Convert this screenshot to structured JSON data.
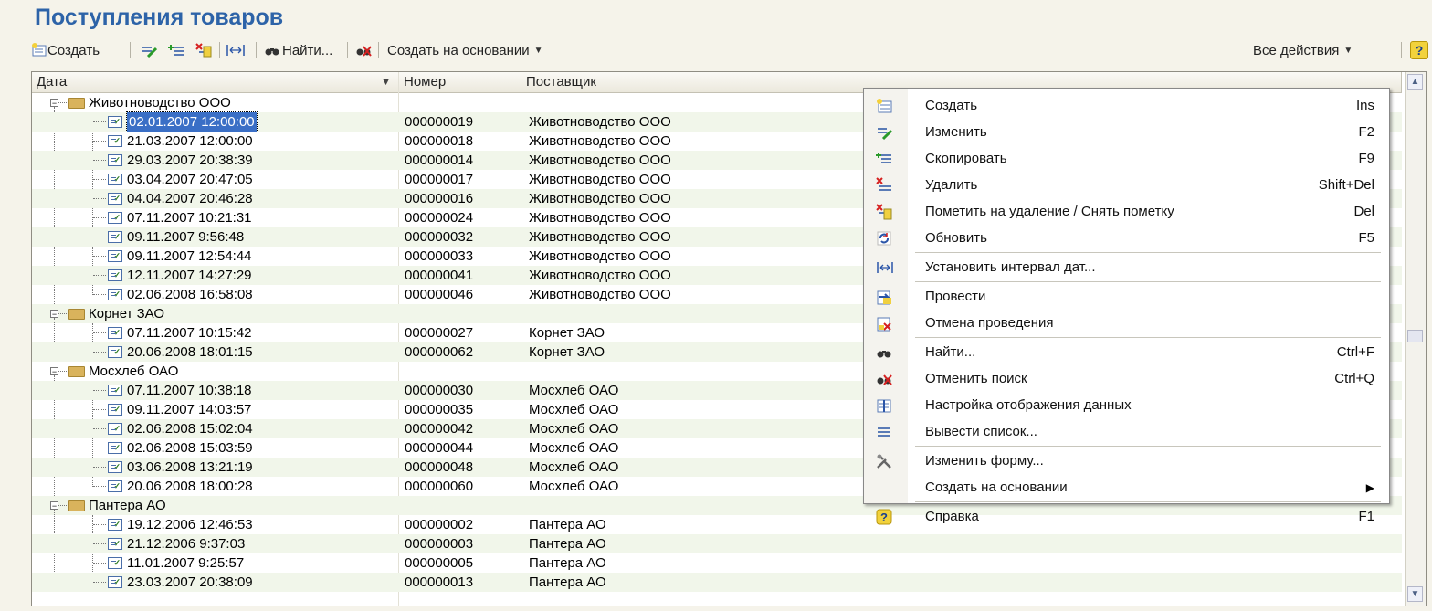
{
  "window": {
    "title": "Поступления товаров"
  },
  "toolbar": {
    "create_label": "Создать",
    "find_label": "Найти...",
    "create_based_label": "Создать на основании",
    "all_actions_label": "Все действия",
    "help_label": "?"
  },
  "table": {
    "columns": [
      "Дата",
      "Номер",
      "Поставщик"
    ],
    "groups": [
      {
        "name": "Животноводство ООО",
        "rows": [
          {
            "date": "02.01.2007 12:00:00",
            "number": "000000019",
            "supplier": "Животноводство ООО",
            "selected": true
          },
          {
            "date": "21.03.2007 12:00:00",
            "number": "000000018",
            "supplier": "Животноводство ООО"
          },
          {
            "date": "29.03.2007 20:38:39",
            "number": "000000014",
            "supplier": "Животноводство ООО"
          },
          {
            "date": "03.04.2007 20:47:05",
            "number": "000000017",
            "supplier": "Животноводство ООО"
          },
          {
            "date": "04.04.2007 20:46:28",
            "number": "000000016",
            "supplier": "Животноводство ООО"
          },
          {
            "date": "07.11.2007 10:21:31",
            "number": "000000024",
            "supplier": "Животноводство ООО"
          },
          {
            "date": "09.11.2007 9:56:48",
            "number": "000000032",
            "supplier": "Животноводство ООО"
          },
          {
            "date": "09.11.2007 12:54:44",
            "number": "000000033",
            "supplier": "Животноводство ООО"
          },
          {
            "date": "12.11.2007 14:27:29",
            "number": "000000041",
            "supplier": "Животноводство ООО"
          },
          {
            "date": "02.06.2008 16:58:08",
            "number": "000000046",
            "supplier": "Животноводство ООО"
          }
        ]
      },
      {
        "name": "Корнет ЗАО",
        "rows": [
          {
            "date": "07.11.2007 10:15:42",
            "number": "000000027",
            "supplier": "Корнет ЗАО"
          },
          {
            "date": "20.06.2008 18:01:15",
            "number": "000000062",
            "supplier": "Корнет ЗАО"
          }
        ]
      },
      {
        "name": "Мосхлеб ОАО",
        "rows": [
          {
            "date": "07.11.2007 10:38:18",
            "number": "000000030",
            "supplier": "Мосхлеб ОАО"
          },
          {
            "date": "09.11.2007 14:03:57",
            "number": "000000035",
            "supplier": "Мосхлеб ОАО"
          },
          {
            "date": "02.06.2008 15:02:04",
            "number": "000000042",
            "supplier": "Мосхлеб ОАО"
          },
          {
            "date": "02.06.2008 15:03:59",
            "number": "000000044",
            "supplier": "Мосхлеб ОАО"
          },
          {
            "date": "03.06.2008 13:21:19",
            "number": "000000048",
            "supplier": "Мосхлеб ОАО"
          },
          {
            "date": "20.06.2008 18:00:28",
            "number": "000000060",
            "supplier": "Мосхлеб ОАО"
          }
        ]
      },
      {
        "name": "Пантера АО",
        "rows": [
          {
            "date": "19.12.2006 12:46:53",
            "number": "000000002",
            "supplier": "Пантера АО"
          },
          {
            "date": "21.12.2006 9:37:03",
            "number": "000000003",
            "supplier": "Пантера АО"
          },
          {
            "date": "11.01.2007 9:25:57",
            "number": "000000005",
            "supplier": "Пантера АО"
          },
          {
            "date": "23.03.2007 20:38:09",
            "number": "000000013",
            "supplier": "Пантера АО"
          }
        ]
      }
    ]
  },
  "context_menu": {
    "items": [
      {
        "icon": "create-icon",
        "label": "Создать",
        "shortcut": "Ins"
      },
      {
        "icon": "edit-icon",
        "label": "Изменить",
        "shortcut": "F2"
      },
      {
        "icon": "copy-icon",
        "label": "Скопировать",
        "shortcut": "F9"
      },
      {
        "icon": "delete-icon",
        "label": "Удалить",
        "shortcut": "Shift+Del"
      },
      {
        "icon": "mark-delete-icon",
        "label": "Пометить на удаление / Снять пометку",
        "shortcut": "Del"
      },
      {
        "icon": "refresh-icon",
        "label": "Обновить",
        "shortcut": "F5",
        "separator_after": true
      },
      {
        "icon": "date-interval-icon",
        "label": "Установить интервал дат...",
        "shortcut": "",
        "separator_after": true
      },
      {
        "icon": "post-icon",
        "label": "Провести",
        "shortcut": ""
      },
      {
        "icon": "unpost-icon",
        "label": "Отмена проведения",
        "shortcut": "",
        "separator_after": true
      },
      {
        "icon": "find-icon",
        "label": "Найти...",
        "shortcut": "Ctrl+F"
      },
      {
        "icon": "cancel-search-icon",
        "label": "Отменить поиск",
        "shortcut": "Ctrl+Q"
      },
      {
        "icon": "display-settings-icon",
        "label": "Настройка отображения данных",
        "shortcut": ""
      },
      {
        "icon": "output-list-icon",
        "label": "Вывести список...",
        "shortcut": "",
        "separator_after": true
      },
      {
        "icon": "edit-form-icon",
        "label": "Изменить форму...",
        "shortcut": ""
      },
      {
        "icon": "",
        "label": "Создать на основании",
        "shortcut": "",
        "submenu": true,
        "separator_after": true
      },
      {
        "icon": "help-icon",
        "label": "Справка",
        "shortcut": "F1"
      }
    ]
  },
  "colors": {
    "title": "#2d63a8",
    "selection": "#3a6fc6",
    "alt_row": "#f1f6ea"
  }
}
